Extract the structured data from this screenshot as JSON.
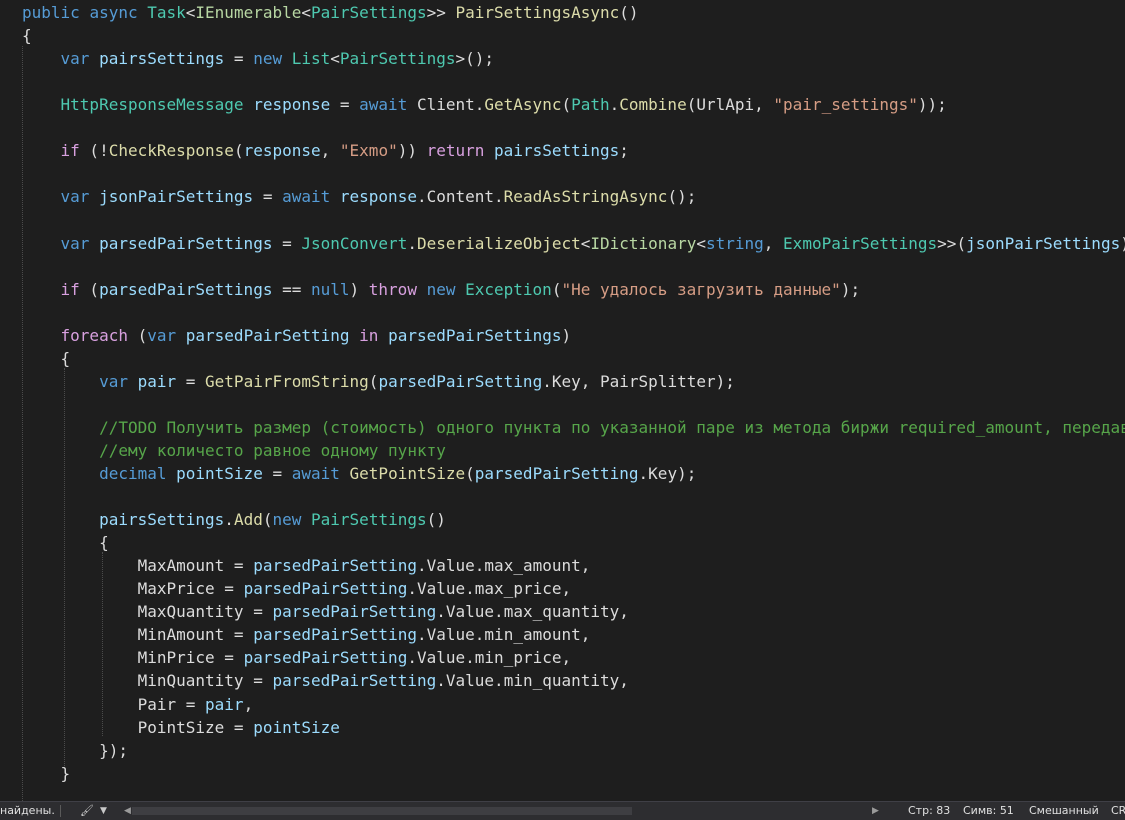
{
  "editor": {
    "lines": [
      [
        [
          "kw",
          "public "
        ],
        [
          "kw",
          "async "
        ],
        [
          "type",
          "Task"
        ],
        [
          "plain",
          "<"
        ],
        [
          "iface",
          "IEnumerable"
        ],
        [
          "plain",
          "<"
        ],
        [
          "type",
          "PairSettings"
        ],
        [
          "plain",
          ">> "
        ],
        [
          "fn",
          "PairSettingsAsync"
        ],
        [
          "plain",
          "()"
        ]
      ],
      [
        [
          "plain",
          "{"
        ]
      ],
      [
        [
          "plain",
          "    "
        ],
        [
          "kw",
          "var "
        ],
        [
          "var",
          "pairsSettings"
        ],
        [
          "plain",
          " = "
        ],
        [
          "kw",
          "new "
        ],
        [
          "type",
          "List"
        ],
        [
          "plain",
          "<"
        ],
        [
          "type",
          "PairSettings"
        ],
        [
          "plain",
          ">();"
        ]
      ],
      [],
      [
        [
          "plain",
          "    "
        ],
        [
          "type",
          "HttpResponseMessage "
        ],
        [
          "var",
          "response"
        ],
        [
          "plain",
          " = "
        ],
        [
          "kw",
          "await "
        ],
        [
          "prop",
          "Client"
        ],
        [
          "plain",
          "."
        ],
        [
          "fn",
          "GetAsync"
        ],
        [
          "plain",
          "("
        ],
        [
          "type",
          "Path"
        ],
        [
          "plain",
          "."
        ],
        [
          "fn",
          "Combine"
        ],
        [
          "plain",
          "(UrlApi, "
        ],
        [
          "str",
          "\"pair_settings\""
        ],
        [
          "plain",
          "));"
        ]
      ],
      [],
      [
        [
          "plain",
          "    "
        ],
        [
          "ctrl",
          "if"
        ],
        [
          "plain",
          " (!"
        ],
        [
          "fn",
          "CheckResponse"
        ],
        [
          "plain",
          "("
        ],
        [
          "var",
          "response"
        ],
        [
          "plain",
          ", "
        ],
        [
          "str",
          "\"Exmo\""
        ],
        [
          "plain",
          ")) "
        ],
        [
          "ctrl",
          "return "
        ],
        [
          "var",
          "pairsSettings"
        ],
        [
          "plain",
          ";"
        ]
      ],
      [],
      [
        [
          "plain",
          "    "
        ],
        [
          "kw",
          "var "
        ],
        [
          "var",
          "jsonPairSettings"
        ],
        [
          "plain",
          " = "
        ],
        [
          "kw",
          "await "
        ],
        [
          "var",
          "response"
        ],
        [
          "plain",
          "."
        ],
        [
          "prop",
          "Content"
        ],
        [
          "plain",
          "."
        ],
        [
          "fn",
          "ReadAsStringAsync"
        ],
        [
          "plain",
          "();"
        ]
      ],
      [],
      [
        [
          "plain",
          "    "
        ],
        [
          "kw",
          "var "
        ],
        [
          "var",
          "parsedPairSettings"
        ],
        [
          "plain",
          " = "
        ],
        [
          "type",
          "JsonConvert"
        ],
        [
          "plain",
          "."
        ],
        [
          "fn",
          "DeserializeObject"
        ],
        [
          "plain",
          "<"
        ],
        [
          "iface",
          "IDictionary"
        ],
        [
          "plain",
          "<"
        ],
        [
          "kw",
          "string"
        ],
        [
          "plain",
          ", "
        ],
        [
          "type",
          "ExmoPairSettings"
        ],
        [
          "plain",
          ">>("
        ],
        [
          "var",
          "jsonPairSettings"
        ],
        [
          "plain",
          ");"
        ]
      ],
      [],
      [
        [
          "plain",
          "    "
        ],
        [
          "ctrl",
          "if"
        ],
        [
          "plain",
          " ("
        ],
        [
          "var",
          "parsedPairSettings"
        ],
        [
          "plain",
          " == "
        ],
        [
          "kw",
          "null"
        ],
        [
          "plain",
          ") "
        ],
        [
          "ctrl",
          "throw "
        ],
        [
          "kw",
          "new "
        ],
        [
          "type",
          "Exception"
        ],
        [
          "plain",
          "("
        ],
        [
          "str",
          "\"Не удалось загрузить данные\""
        ],
        [
          "plain",
          ");"
        ]
      ],
      [],
      [
        [
          "plain",
          "    "
        ],
        [
          "ctrl",
          "foreach"
        ],
        [
          "plain",
          " ("
        ],
        [
          "kw",
          "var "
        ],
        [
          "var",
          "parsedPairSetting"
        ],
        [
          "plain",
          " "
        ],
        [
          "ctrl",
          "in "
        ],
        [
          "var",
          "parsedPairSettings"
        ],
        [
          "plain",
          ")"
        ]
      ],
      [
        [
          "plain",
          "    {"
        ]
      ],
      [
        [
          "plain",
          "        "
        ],
        [
          "kw",
          "var "
        ],
        [
          "var",
          "pair"
        ],
        [
          "plain",
          " = "
        ],
        [
          "fn",
          "GetPairFromString"
        ],
        [
          "plain",
          "("
        ],
        [
          "var",
          "parsedPairSetting"
        ],
        [
          "plain",
          "."
        ],
        [
          "prop",
          "Key"
        ],
        [
          "plain",
          ", PairSplitter);"
        ]
      ],
      [],
      [
        [
          "plain",
          "        "
        ],
        [
          "cmt",
          "//TODO Получить размер (стоимость) одного пункта по указанной паре из метода биржи required_amount, передав"
        ]
      ],
      [
        [
          "plain",
          "        "
        ],
        [
          "cmt",
          "//ему количесто равное одному пункту"
        ]
      ],
      [
        [
          "plain",
          "        "
        ],
        [
          "kw",
          "decimal "
        ],
        [
          "var",
          "pointSize"
        ],
        [
          "plain",
          " = "
        ],
        [
          "kw",
          "await "
        ],
        [
          "fn",
          "GetPointSize"
        ],
        [
          "plain",
          "("
        ],
        [
          "var",
          "parsedPairSetting"
        ],
        [
          "plain",
          "."
        ],
        [
          "prop",
          "Key"
        ],
        [
          "plain",
          ");"
        ]
      ],
      [],
      [
        [
          "plain",
          "        "
        ],
        [
          "var",
          "pairsSettings"
        ],
        [
          "plain",
          "."
        ],
        [
          "fn",
          "Add"
        ],
        [
          "plain",
          "("
        ],
        [
          "kw",
          "new "
        ],
        [
          "type",
          "PairSettings"
        ],
        [
          "plain",
          "()"
        ]
      ],
      [
        [
          "plain",
          "        {"
        ]
      ],
      [
        [
          "plain",
          "            "
        ],
        [
          "prop",
          "MaxAmount"
        ],
        [
          "plain",
          " = "
        ],
        [
          "var",
          "parsedPairSetting"
        ],
        [
          "plain",
          "."
        ],
        [
          "prop",
          "Value"
        ],
        [
          "plain",
          "."
        ],
        [
          "prop",
          "max_amount"
        ],
        [
          "plain",
          ","
        ]
      ],
      [
        [
          "plain",
          "            "
        ],
        [
          "prop",
          "MaxPrice"
        ],
        [
          "plain",
          " = "
        ],
        [
          "var",
          "parsedPairSetting"
        ],
        [
          "plain",
          "."
        ],
        [
          "prop",
          "Value"
        ],
        [
          "plain",
          "."
        ],
        [
          "prop",
          "max_price"
        ],
        [
          "plain",
          ","
        ]
      ],
      [
        [
          "plain",
          "            "
        ],
        [
          "prop",
          "MaxQuantity"
        ],
        [
          "plain",
          " = "
        ],
        [
          "var",
          "parsedPairSetting"
        ],
        [
          "plain",
          "."
        ],
        [
          "prop",
          "Value"
        ],
        [
          "plain",
          "."
        ],
        [
          "prop",
          "max_quantity"
        ],
        [
          "plain",
          ","
        ]
      ],
      [
        [
          "plain",
          "            "
        ],
        [
          "prop",
          "MinAmount"
        ],
        [
          "plain",
          " = "
        ],
        [
          "var",
          "parsedPairSetting"
        ],
        [
          "plain",
          "."
        ],
        [
          "prop",
          "Value"
        ],
        [
          "plain",
          "."
        ],
        [
          "prop",
          "min_amount"
        ],
        [
          "plain",
          ","
        ]
      ],
      [
        [
          "plain",
          "            "
        ],
        [
          "prop",
          "MinPrice"
        ],
        [
          "plain",
          " = "
        ],
        [
          "var",
          "parsedPairSetting"
        ],
        [
          "plain",
          "."
        ],
        [
          "prop",
          "Value"
        ],
        [
          "plain",
          "."
        ],
        [
          "prop",
          "min_price"
        ],
        [
          "plain",
          ","
        ]
      ],
      [
        [
          "plain",
          "            "
        ],
        [
          "prop",
          "MinQuantity"
        ],
        [
          "plain",
          " = "
        ],
        [
          "var",
          "parsedPairSetting"
        ],
        [
          "plain",
          "."
        ],
        [
          "prop",
          "Value"
        ],
        [
          "plain",
          "."
        ],
        [
          "prop",
          "min_quantity"
        ],
        [
          "plain",
          ","
        ]
      ],
      [
        [
          "plain",
          "            "
        ],
        [
          "prop",
          "Pair"
        ],
        [
          "plain",
          " = "
        ],
        [
          "var",
          "pair"
        ],
        [
          "plain",
          ","
        ]
      ],
      [
        [
          "plain",
          "            "
        ],
        [
          "prop",
          "PointSize"
        ],
        [
          "plain",
          " = "
        ],
        [
          "var",
          "pointSize"
        ]
      ],
      [
        [
          "plain",
          "        });"
        ]
      ],
      [
        [
          "plain",
          "    }"
        ]
      ]
    ]
  },
  "status_bar": {
    "message": "найдены.",
    "line": "Стр: 83",
    "column": "Симв: 51",
    "mode": "Смешанный",
    "line_ending": "CRLF"
  },
  "colors": {
    "background": "#1e1e1e",
    "keyword": "#569cd6",
    "control": "#d8a0df",
    "type": "#4ec9b0",
    "method": "#dcdcaa",
    "variable": "#9cdcfe",
    "string": "#d69d85",
    "comment": "#57a64a"
  },
  "icons": [
    "error-indicator-icon",
    "brush-icon",
    "chevron-down-icon",
    "scroll-left-icon",
    "scroll-right-icon"
  ]
}
